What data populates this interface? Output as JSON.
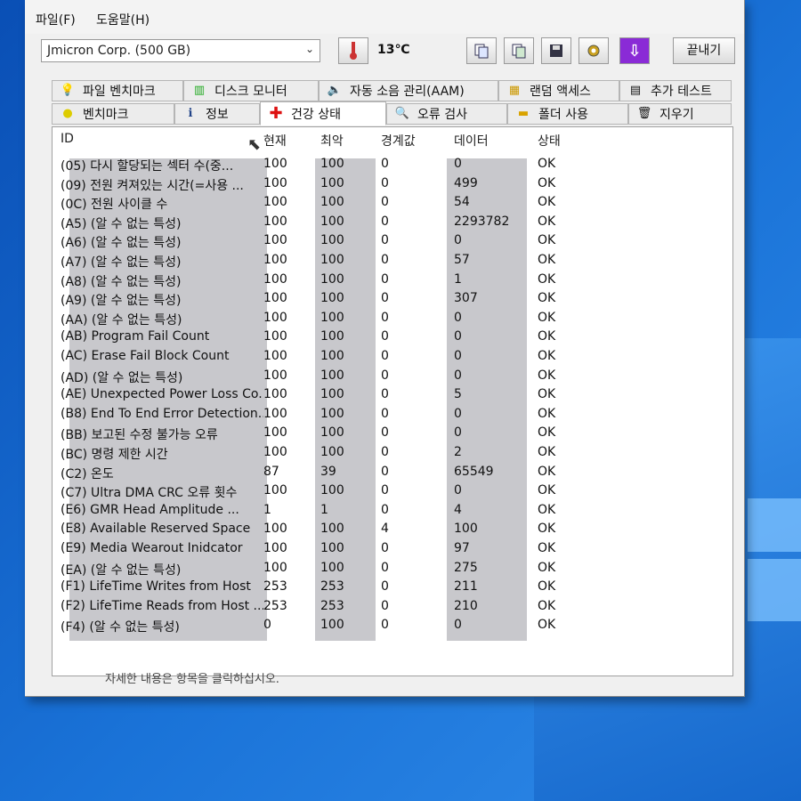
{
  "menu": {
    "file": "파일(F)",
    "help": "도움말(H)"
  },
  "toolbar": {
    "drive": "Jmicron Corp. (500 GB)",
    "temperature": "13℃",
    "close_label": "끝내기"
  },
  "tabs_row1": [
    {
      "label": "파일 벤치마크",
      "icon": "file-bench-icon"
    },
    {
      "label": "디스크 모니터",
      "icon": "chart-icon"
    },
    {
      "label": "자동 소음 관리(AAM)",
      "icon": "speaker-icon"
    },
    {
      "label": "랜덤 액세스",
      "icon": "random-access-icon"
    },
    {
      "label": "추가 테스트",
      "icon": "calculator-icon"
    }
  ],
  "tabs_row2": [
    {
      "label": "벤치마크",
      "icon": "lightbulb-icon"
    },
    {
      "label": "정보",
      "icon": "info-icon"
    },
    {
      "label": "건강 상태",
      "icon": "red-cross-icon"
    },
    {
      "label": "오류 검사",
      "icon": "magnifier-icon"
    },
    {
      "label": "폴더 사용",
      "icon": "folder-icon"
    },
    {
      "label": "지우기",
      "icon": "trash-icon"
    }
  ],
  "table": {
    "headers": {
      "id": "ID",
      "current": "현재",
      "worst": "최악",
      "threshold": "경계값",
      "data": "데이터",
      "status": "상태"
    },
    "rows": [
      [
        "(05) 다시 할당되는 섹터 수(중...",
        "100",
        "100",
        "0",
        "0",
        "OK"
      ],
      [
        "(09) 전원 켜져있는 시간(=사용 ...",
        "100",
        "100",
        "0",
        "499",
        "OK"
      ],
      [
        "(0C) 전원 사이클 수",
        "100",
        "100",
        "0",
        "54",
        "OK"
      ],
      [
        "(A5) (알 수 없는 특성)",
        "100",
        "100",
        "0",
        "2293782",
        "OK"
      ],
      [
        "(A6) (알 수 없는 특성)",
        "100",
        "100",
        "0",
        "0",
        "OK"
      ],
      [
        "(A7) (알 수 없는 특성)",
        "100",
        "100",
        "0",
        "57",
        "OK"
      ],
      [
        "(A8) (알 수 없는 특성)",
        "100",
        "100",
        "0",
        "1",
        "OK"
      ],
      [
        "(A9) (알 수 없는 특성)",
        "100",
        "100",
        "0",
        "307",
        "OK"
      ],
      [
        "(AA) (알 수 없는 특성)",
        "100",
        "100",
        "0",
        "0",
        "OK"
      ],
      [
        "(AB) Program Fail Count",
        "100",
        "100",
        "0",
        "0",
        "OK"
      ],
      [
        "(AC) Erase Fail Block Count",
        "100",
        "100",
        "0",
        "0",
        "OK"
      ],
      [
        "(AD) (알 수 없는 특성)",
        "100",
        "100",
        "0",
        "0",
        "OK"
      ],
      [
        "(AE) Unexpected Power Loss Co...",
        "100",
        "100",
        "0",
        "5",
        "OK"
      ],
      [
        "(B8) End To End Error Detection...",
        "100",
        "100",
        "0",
        "0",
        "OK"
      ],
      [
        "(BB) 보고된 수정 불가능 오류",
        "100",
        "100",
        "0",
        "0",
        "OK"
      ],
      [
        "(BC) 명령 제한 시간",
        "100",
        "100",
        "0",
        "2",
        "OK"
      ],
      [
        "(C2) 온도",
        "87",
        "39",
        "0",
        "65549",
        "OK"
      ],
      [
        "(C7) Ultra DMA CRC 오류 횟수",
        "100",
        "100",
        "0",
        "0",
        "OK"
      ],
      [
        "(E6) GMR Head Amplitude ...",
        "1",
        "1",
        "0",
        "4",
        "OK"
      ],
      [
        "(E8) Available Reserved Space",
        "100",
        "100",
        "4",
        "100",
        "OK"
      ],
      [
        "(E9) Media Wearout Inidcator",
        "100",
        "100",
        "0",
        "97",
        "OK"
      ],
      [
        "(EA) (알 수 없는 특성)",
        "100",
        "100",
        "0",
        "275",
        "OK"
      ],
      [
        "(F1) LifeTime Writes from Host",
        "253",
        "253",
        "0",
        "211",
        "OK"
      ],
      [
        "(F2) LifeTime Reads from Host ...",
        "253",
        "253",
        "0",
        "210",
        "OK"
      ],
      [
        "(F4) (알 수 없는 특성)",
        "0",
        "100",
        "0",
        "0",
        "OK"
      ]
    ]
  },
  "status_bar": "자세한 내용은 항목을 클릭하십시오."
}
